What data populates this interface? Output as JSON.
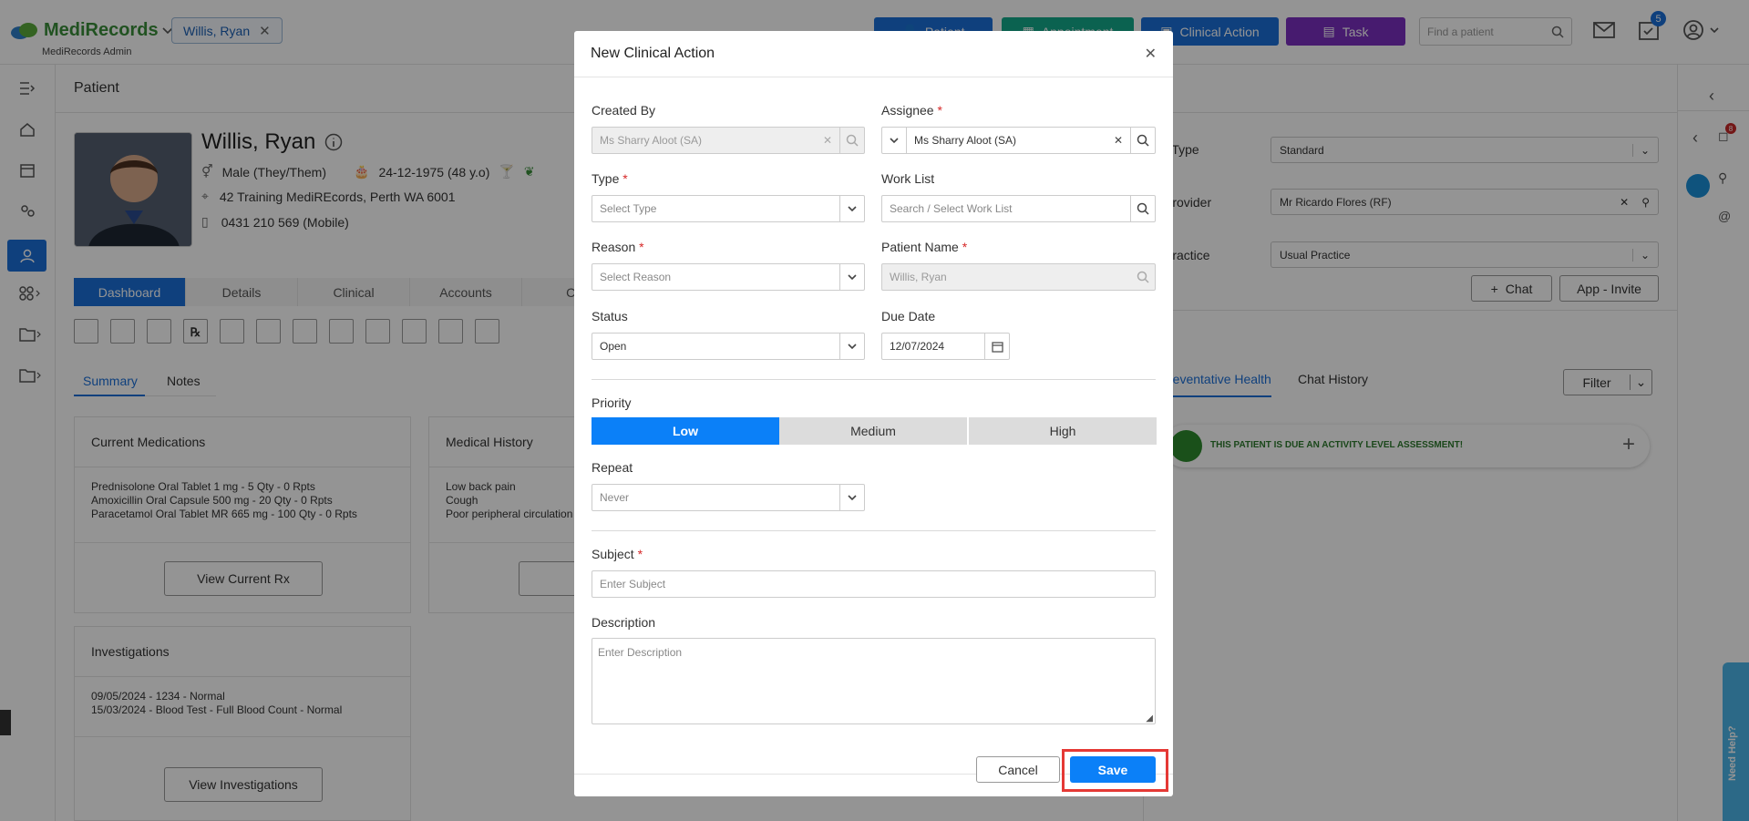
{
  "app": {
    "brand": "MediRecords",
    "role": "MediRecords Admin",
    "patient_chip": "Willis, Ryan",
    "buttons": {
      "patient": "Patient",
      "appointment": "Appointment",
      "clinical_action": "Clinical Action",
      "task": "Task"
    },
    "find_placeholder": "Find a patient",
    "notification_count": "5",
    "colors": {
      "patient_btn": "#1b6fd8",
      "appointment_btn": "#14a98a",
      "clinical_btn": "#1b6fd8",
      "task_btn": "#7b2fbf",
      "accent": "#0b80f8"
    }
  },
  "patient": {
    "section_title": "Patient",
    "name": "Willis, Ryan",
    "gender": "Male (They/Them)",
    "dob": "24-12-1975 (48 y.o)",
    "address": "42 Training MediREcords, Perth WA 6001",
    "phone": "0431 210 569 (Mobile)",
    "tabs": [
      "Dashboard",
      "Details",
      "Clinical",
      "Accounts",
      "Con"
    ],
    "subtabs": [
      "Summary",
      "Notes"
    ]
  },
  "cards": {
    "medications": {
      "title": "Current Medications",
      "lines": [
        "Prednisolone Oral Tablet 1 mg - 5 Qty - 0 Rpts",
        "Amoxicillin Oral Capsule 500 mg - 20 Qty - 0 Rpts",
        "Paracetamol Oral Tablet MR 665 mg - 100 Qty - 0 Rpts"
      ],
      "button": "View Current Rx"
    },
    "history": {
      "title": "Medical History",
      "lines": [
        "Low back pain",
        "Cough",
        "Poor peripheral circulation"
      ],
      "button": "View"
    },
    "investigations": {
      "title": "Investigations",
      "lines": [
        "09/05/2024 - 1234 - Normal",
        "15/03/2024 - Blood Test - Full Blood Count - Normal"
      ],
      "button": "View Investigations"
    }
  },
  "right_panel": {
    "rows": [
      {
        "label": "nt Type",
        "value": "Standard"
      },
      {
        "label": "l Provider",
        "value": "Mr Ricardo Flores (RF)"
      },
      {
        "label": "l Practice",
        "value": "Usual Practice"
      }
    ],
    "chat": "Chat",
    "app_invite": "App - Invite",
    "tabs": [
      "reventative Health",
      "Chat History"
    ],
    "filter": "Filter",
    "alert": "THIS PATIENT IS DUE AN ACTIVITY LEVEL ASSESSMENT!",
    "help": "Need Help?",
    "badge_count": "8"
  },
  "modal": {
    "title": "New Clinical Action",
    "created_by": {
      "label": "Created By",
      "value": "Ms Sharry Aloot (SA)"
    },
    "assignee": {
      "label": "Assignee",
      "value": "Ms Sharry Aloot (SA)"
    },
    "type": {
      "label": "Type",
      "placeholder": "Select Type"
    },
    "work_list": {
      "label": "Work List",
      "placeholder": "Search / Select Work List"
    },
    "reason": {
      "label": "Reason",
      "placeholder": "Select Reason"
    },
    "patient_name": {
      "label": "Patient Name",
      "value": "Willis, Ryan"
    },
    "status": {
      "label": "Status",
      "value": "Open"
    },
    "due_date": {
      "label": "Due Date",
      "value": "12/07/2024"
    },
    "priority": {
      "label": "Priority",
      "options": [
        "Low",
        "Medium",
        "High"
      ],
      "selected": "Low"
    },
    "repeat": {
      "label": "Repeat",
      "value": "Never"
    },
    "subject": {
      "label": "Subject",
      "placeholder": "Enter Subject"
    },
    "description": {
      "label": "Description",
      "placeholder": "Enter Description"
    },
    "cancel": "Cancel",
    "save": "Save",
    "required_mark": "*"
  }
}
